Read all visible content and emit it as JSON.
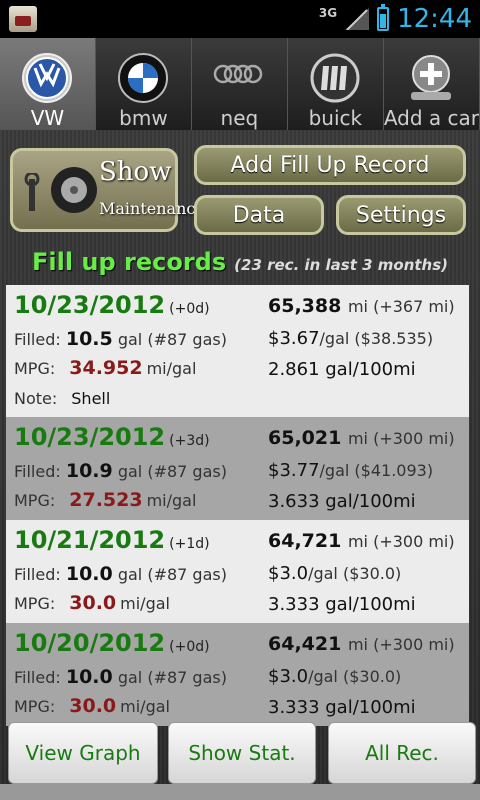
{
  "status_bar": {
    "network": "3G",
    "time": "12:44"
  },
  "tabs": [
    {
      "label": "VW",
      "icon": "vw-logo-icon",
      "active": true
    },
    {
      "label": "bmw",
      "icon": "bmw-logo-icon",
      "active": false
    },
    {
      "label": "neq",
      "icon": "audi-logo-icon",
      "active": false
    },
    {
      "label": "buick",
      "icon": "buick-logo-icon",
      "active": false
    },
    {
      "label": "Add a car",
      "icon": "add-car-icon",
      "active": false
    }
  ],
  "actions": {
    "show_label": "Show",
    "maintenance_label": "Maintenance",
    "add_fill_up": "Add Fill Up Record",
    "data": "Data",
    "settings": "Settings"
  },
  "records_header": {
    "title": "Fill up records",
    "summary": "(23 rec. in last 3 months)"
  },
  "labels": {
    "filled": "Filled:",
    "mpg": "MPG:",
    "note": "Note:"
  },
  "records": [
    {
      "date": "10/23/2012",
      "delta": "(+0d)",
      "odometer": "65,388",
      "odo_delta": "mi (+367 mi)",
      "filled_amount": "10.5",
      "filled_detail": "gal (#87 gas)",
      "price": "$3.67",
      "price_detail": "/gal ($38.535)",
      "mpg": "34.952",
      "mpg_unit": "mi/gal",
      "per100": "2.861 gal/100mi",
      "note": "Shell"
    },
    {
      "date": "10/23/2012",
      "delta": "(+3d)",
      "odometer": "65,021",
      "odo_delta": "mi (+300 mi)",
      "filled_amount": "10.9",
      "filled_detail": "gal (#87 gas)",
      "price": "$3.77",
      "price_detail": "/gal ($41.093)",
      "mpg": "27.523",
      "mpg_unit": "mi/gal",
      "per100": "3.633 gal/100mi",
      "note": ""
    },
    {
      "date": "10/21/2012",
      "delta": "(+1d)",
      "odometer": "64,721",
      "odo_delta": "mi (+300 mi)",
      "filled_amount": "10.0",
      "filled_detail": "gal (#87 gas)",
      "price": "$3.0",
      "price_detail": "/gal ($30.0)",
      "mpg": "30.0",
      "mpg_unit": "mi/gal",
      "per100": "3.333 gal/100mi",
      "note": ""
    },
    {
      "date": "10/20/2012",
      "delta": "(+0d)",
      "odometer": "64,421",
      "odo_delta": "mi (+300 mi)",
      "filled_amount": "10.0",
      "filled_detail": "gal (#87 gas)",
      "price": "$3.0",
      "price_detail": "/gal ($30.0)",
      "mpg": "30.0",
      "mpg_unit": "mi/gal",
      "per100": "3.333 gal/100mi",
      "note": ""
    }
  ],
  "bottom_buttons": {
    "view_graph": "View Graph",
    "show_stat": "Show Stat.",
    "all_rec": "All Rec."
  },
  "colors": {
    "accent_green": "#1a7a12",
    "mpg_red": "#8a1a1a",
    "header_green": "#66ee44",
    "clock_blue": "#33b5e5"
  }
}
